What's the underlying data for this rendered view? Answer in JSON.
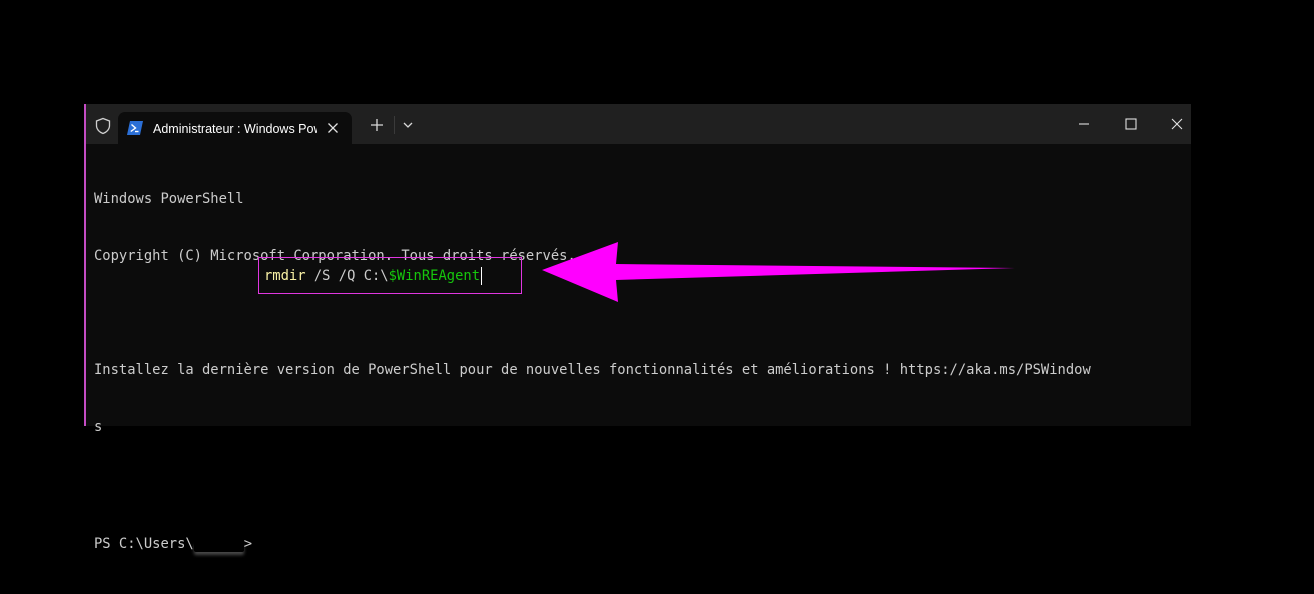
{
  "window": {
    "tab_title": "Administrateur : Windows PowerShell"
  },
  "terminal": {
    "line1": "Windows PowerShell",
    "line2": "Copyright (C) Microsoft Corporation. Tous droits réservés.",
    "line3": "Installez la dernière version de PowerShell pour de nouvelles fonctionnalités et améliorations ! https://aka.ms/PSWindow",
    "line4": "s",
    "prompt_prefix": "PS C:\\Users\\",
    "prompt_suffix": ">",
    "command": {
      "verb": "rmdir",
      "args": " /S /Q C:\\",
      "variable": "$WinREAgent"
    }
  },
  "colors": {
    "accent": "#e036e0",
    "command_yellow": "#f9f1a5",
    "variable_green": "#16c60c",
    "arrow": "#ff00ff"
  },
  "icons": {
    "shield": "shield-icon",
    "powershell": "powershell-icon",
    "close": "close-icon",
    "plus": "plus-icon",
    "chevron": "chevron-down-icon",
    "minimize": "minimize-icon",
    "maximize": "maximize-icon",
    "window_close": "window-close-icon",
    "arrow": "arrow-left-icon"
  }
}
